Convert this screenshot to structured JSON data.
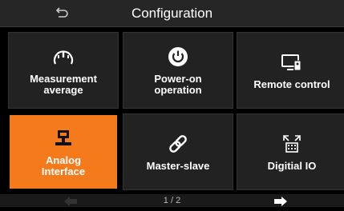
{
  "header": {
    "title": "Configuration",
    "back_icon": "return-arrow-icon"
  },
  "tiles": [
    {
      "label_line1": "Measurement",
      "label_line2": "average",
      "icon": "gauge-icon"
    },
    {
      "label_line1": "Power-on",
      "label_line2": "operation",
      "icon": "power-icon"
    },
    {
      "label_line1": "Remote control",
      "label_line2": "",
      "icon": "remote-monitor-icon"
    },
    {
      "label_line1": "Analog",
      "label_line2": "Interface",
      "icon": "analog-interface-icon",
      "selected": true
    },
    {
      "label_line1": "Master-slave",
      "label_line2": "",
      "icon": "link-icon"
    },
    {
      "label_line1": "Digitial IO",
      "label_line2": "",
      "icon": "digital-io-icon"
    }
  ],
  "footer": {
    "page_indicator": "1 / 2",
    "prev_icon": "left-arrow-icon",
    "next_icon": "right-arrow-icon"
  },
  "colors": {
    "selected_tile": "#f47a1c",
    "tile_bg": "#222222",
    "header_bg": "#262626",
    "prev_arrow_disabled": "#333333",
    "next_arrow": "#ffffff"
  }
}
